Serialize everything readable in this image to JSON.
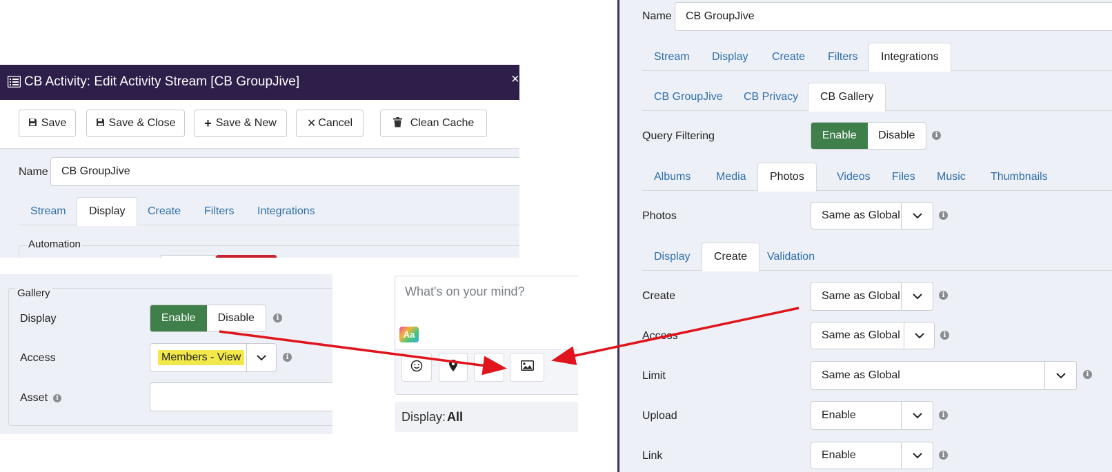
{
  "window": {
    "title": "CB Activity: Edit Activity Stream [CB GroupJive]",
    "close_glyph": "×"
  },
  "toolbar": {
    "save": "Save",
    "save_close": "Save & Close",
    "save_new": "Save & New",
    "cancel": "Cancel",
    "clean_cache": "Clean Cache"
  },
  "left_form": {
    "name_label": "Name",
    "name_value": "CB GroupJive",
    "tabs": [
      "Stream",
      "Display",
      "Create",
      "Filters",
      "Integrations"
    ],
    "active_tab": "Display",
    "section_legend": "Automation"
  },
  "gallery": {
    "legend": "Gallery",
    "display_label": "Display",
    "enable": "Enable",
    "disable": "Disable",
    "access_label": "Access",
    "access_value": "Members - View",
    "asset_label": "Asset",
    "asset_value": ""
  },
  "composer": {
    "placeholder": "What's on your mind?",
    "format_badge": "Aa",
    "display_prefix": "Display:",
    "display_value": "All"
  },
  "right_form": {
    "name_label": "Name",
    "name_value": "CB GroupJive",
    "main_tabs": [
      "Stream",
      "Display",
      "Create",
      "Filters",
      "Integrations"
    ],
    "main_active": "Integrations",
    "integration_tabs": [
      "CB GroupJive",
      "CB Privacy",
      "CB Gallery"
    ],
    "integration_active": "CB Gallery",
    "query_filtering_label": "Query Filtering",
    "enable": "Enable",
    "disable": "Disable",
    "gallery_tabs": [
      "Albums",
      "Media",
      "Photos",
      "Videos",
      "Files",
      "Music",
      "Thumbnails"
    ],
    "gallery_active": "Photos",
    "photos_label": "Photos",
    "photos_value": "Same as Global",
    "photo_sub_tabs": [
      "Display",
      "Create",
      "Validation"
    ],
    "photo_sub_active": "Create",
    "create_label": "Create",
    "create_value": "Same as Global",
    "access_label": "Access",
    "access_value": "Same as Global",
    "limit_label": "Limit",
    "limit_value": "Same as Global",
    "upload_label": "Upload",
    "upload_value": "Enable",
    "link_label": "Link",
    "link_value": "Enable"
  },
  "colors": {
    "title_bar": "#2e1f4a",
    "enable_active": "#3f7f4a",
    "link_blue": "#2f6fab",
    "highlight": "#f3e84a",
    "arrow_red": "#e0141c"
  },
  "icons": [
    "list-icon",
    "floppy-disk-icon",
    "plus-icon",
    "times-icon",
    "trash-icon",
    "chevron-down-icon",
    "info-icon",
    "smiley-icon",
    "map-pin-icon",
    "user-icon",
    "image-icon"
  ]
}
